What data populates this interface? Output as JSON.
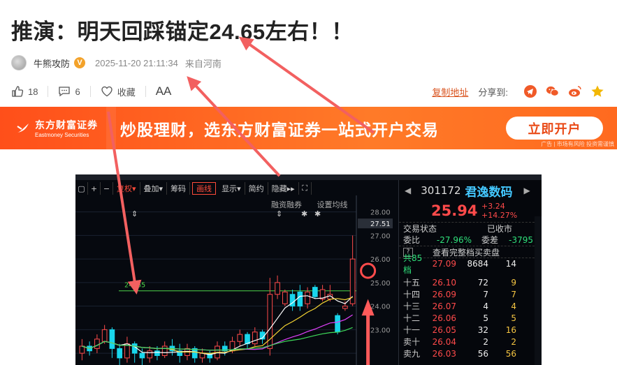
{
  "article": {
    "title": "推演：明天回踩锚定24.65左右！！",
    "author": "牛熊攻防",
    "verified_badge": "V",
    "time": "2025-11-20 21:11:34",
    "location": "来自河南"
  },
  "actions": {
    "likes": "18",
    "comments": "6",
    "favorite_label": "收藏",
    "font_label": "AA",
    "copy_link": "复制地址",
    "share_label": "分享到:"
  },
  "banner": {
    "logo_cn": "东方财富证券",
    "logo_en": "Eastmoney Securities",
    "slogan": "炒股理财，选东方财富证券一站式开户交易",
    "button": "立即开户",
    "ad_note": "广告 | 市场有风险 投资需谨慎"
  },
  "chart_toolbar": {
    "items": [
      "复权",
      "叠加",
      "筹码",
      "画线",
      "显示",
      "简约",
      "隐藏"
    ],
    "sub_labels": [
      "融资融券",
      "设置均线"
    ]
  },
  "chart_data": {
    "type": "candlestick",
    "anchor_line": {
      "label": "24.65",
      "value": 24.65
    },
    "price_axis": [
      "28.00",
      "27.00",
      "26.00",
      "25.00",
      "24.00",
      "23.00"
    ],
    "current_price_tag": "27.51",
    "candles": [
      {
        "o": 22.0,
        "c": 22.3,
        "h": 22.6,
        "l": 21.7
      },
      {
        "o": 22.3,
        "c": 22.1,
        "h": 22.5,
        "l": 21.9
      },
      {
        "o": 22.2,
        "c": 22.6,
        "h": 22.8,
        "l": 22.0
      },
      {
        "o": 22.5,
        "c": 23.0,
        "h": 23.2,
        "l": 22.4
      },
      {
        "o": 23.0,
        "c": 22.2,
        "h": 23.1,
        "l": 21.8
      },
      {
        "o": 22.2,
        "c": 21.8,
        "h": 22.4,
        "l": 21.5
      },
      {
        "o": 21.8,
        "c": 22.4,
        "h": 22.7,
        "l": 21.6
      },
      {
        "o": 22.4,
        "c": 22.0,
        "h": 22.5,
        "l": 21.6
      },
      {
        "o": 22.0,
        "c": 21.8,
        "h": 22.2,
        "l": 21.5
      },
      {
        "o": 21.8,
        "c": 22.1,
        "h": 22.3,
        "l": 21.6
      },
      {
        "o": 22.1,
        "c": 21.9,
        "h": 22.3,
        "l": 21.7
      },
      {
        "o": 21.9,
        "c": 22.3,
        "h": 22.5,
        "l": 21.8
      },
      {
        "o": 22.3,
        "c": 22.1,
        "h": 22.6,
        "l": 21.9
      },
      {
        "o": 22.1,
        "c": 21.9,
        "h": 22.4,
        "l": 21.6
      },
      {
        "o": 21.9,
        "c": 22.2,
        "h": 22.4,
        "l": 21.7
      },
      {
        "o": 22.2,
        "c": 21.8,
        "h": 22.3,
        "l": 21.6
      },
      {
        "o": 21.8,
        "c": 22.0,
        "h": 22.2,
        "l": 21.6
      },
      {
        "o": 22.0,
        "c": 21.8,
        "h": 22.1,
        "l": 21.6
      },
      {
        "o": 21.8,
        "c": 22.3,
        "h": 22.5,
        "l": 21.7
      },
      {
        "o": 22.3,
        "c": 22.1,
        "h": 22.5,
        "l": 21.9
      },
      {
        "o": 22.1,
        "c": 22.5,
        "h": 22.7,
        "l": 22.0
      },
      {
        "o": 22.5,
        "c": 22.8,
        "h": 23.0,
        "l": 22.3
      },
      {
        "o": 22.8,
        "c": 22.4,
        "h": 22.9,
        "l": 22.2
      },
      {
        "o": 22.4,
        "c": 22.9,
        "h": 23.1,
        "l": 22.3
      },
      {
        "o": 22.9,
        "c": 22.6,
        "h": 23.0,
        "l": 22.4
      },
      {
        "o": 22.2,
        "c": 24.5,
        "h": 25.2,
        "l": 21.9
      },
      {
        "o": 24.5,
        "c": 25.0,
        "h": 25.3,
        "l": 24.3
      },
      {
        "o": 24.1,
        "c": 24.6,
        "h": 24.7,
        "l": 24.0
      },
      {
        "o": 24.5,
        "c": 24.0,
        "h": 24.7,
        "l": 23.8
      },
      {
        "o": 24.6,
        "c": 24.0,
        "h": 24.9,
        "l": 23.8
      },
      {
        "o": 24.1,
        "c": 24.6,
        "h": 24.8,
        "l": 23.9
      },
      {
        "o": 24.8,
        "c": 24.4,
        "h": 24.9,
        "l": 24.3
      },
      {
        "o": 24.3,
        "c": 24.7,
        "h": 24.9,
        "l": 24.2
      },
      {
        "o": 24.3,
        "c": 24.5,
        "h": 24.9,
        "l": 24.2
      },
      {
        "o": 23.6,
        "c": 22.9,
        "h": 23.7,
        "l": 22.8
      },
      {
        "o": 23.9,
        "c": 24.0,
        "h": 24.2,
        "l": 23.8
      },
      {
        "o": 24.1,
        "c": 26.0,
        "h": 27.0,
        "l": 24.0
      }
    ],
    "ylim": [
      21.5,
      28.7
    ]
  },
  "quote": {
    "code": "301172",
    "name": "君逸数码",
    "price": "25.94",
    "change": "+3.24",
    "change_pct": "+14.27%",
    "status_label": "交易状态",
    "status_value": "已收市",
    "wb_label": "委比",
    "wb_value": "-27.96%",
    "wc_label": "委差",
    "wc_value": "-3795",
    "full_book": "查看完整档买卖盘",
    "total_label": "共85档",
    "total_price": "27.09",
    "total_vol": "8684",
    "total_n": "14",
    "book": [
      {
        "label": "十五",
        "price": "26.10",
        "vol": "72",
        "n": "9"
      },
      {
        "label": "十四",
        "price": "26.09",
        "vol": "7",
        "n": "7"
      },
      {
        "label": "十三",
        "price": "26.07",
        "vol": "4",
        "n": "4"
      },
      {
        "label": "十二",
        "price": "26.06",
        "vol": "5",
        "n": "5"
      },
      {
        "label": "十一",
        "price": "26.05",
        "vol": "32",
        "n": "16"
      },
      {
        "label": "卖十",
        "price": "26.04",
        "vol": "2",
        "n": "2"
      },
      {
        "label": "卖九",
        "price": "26.03",
        "vol": "56",
        "n": "56"
      }
    ]
  }
}
